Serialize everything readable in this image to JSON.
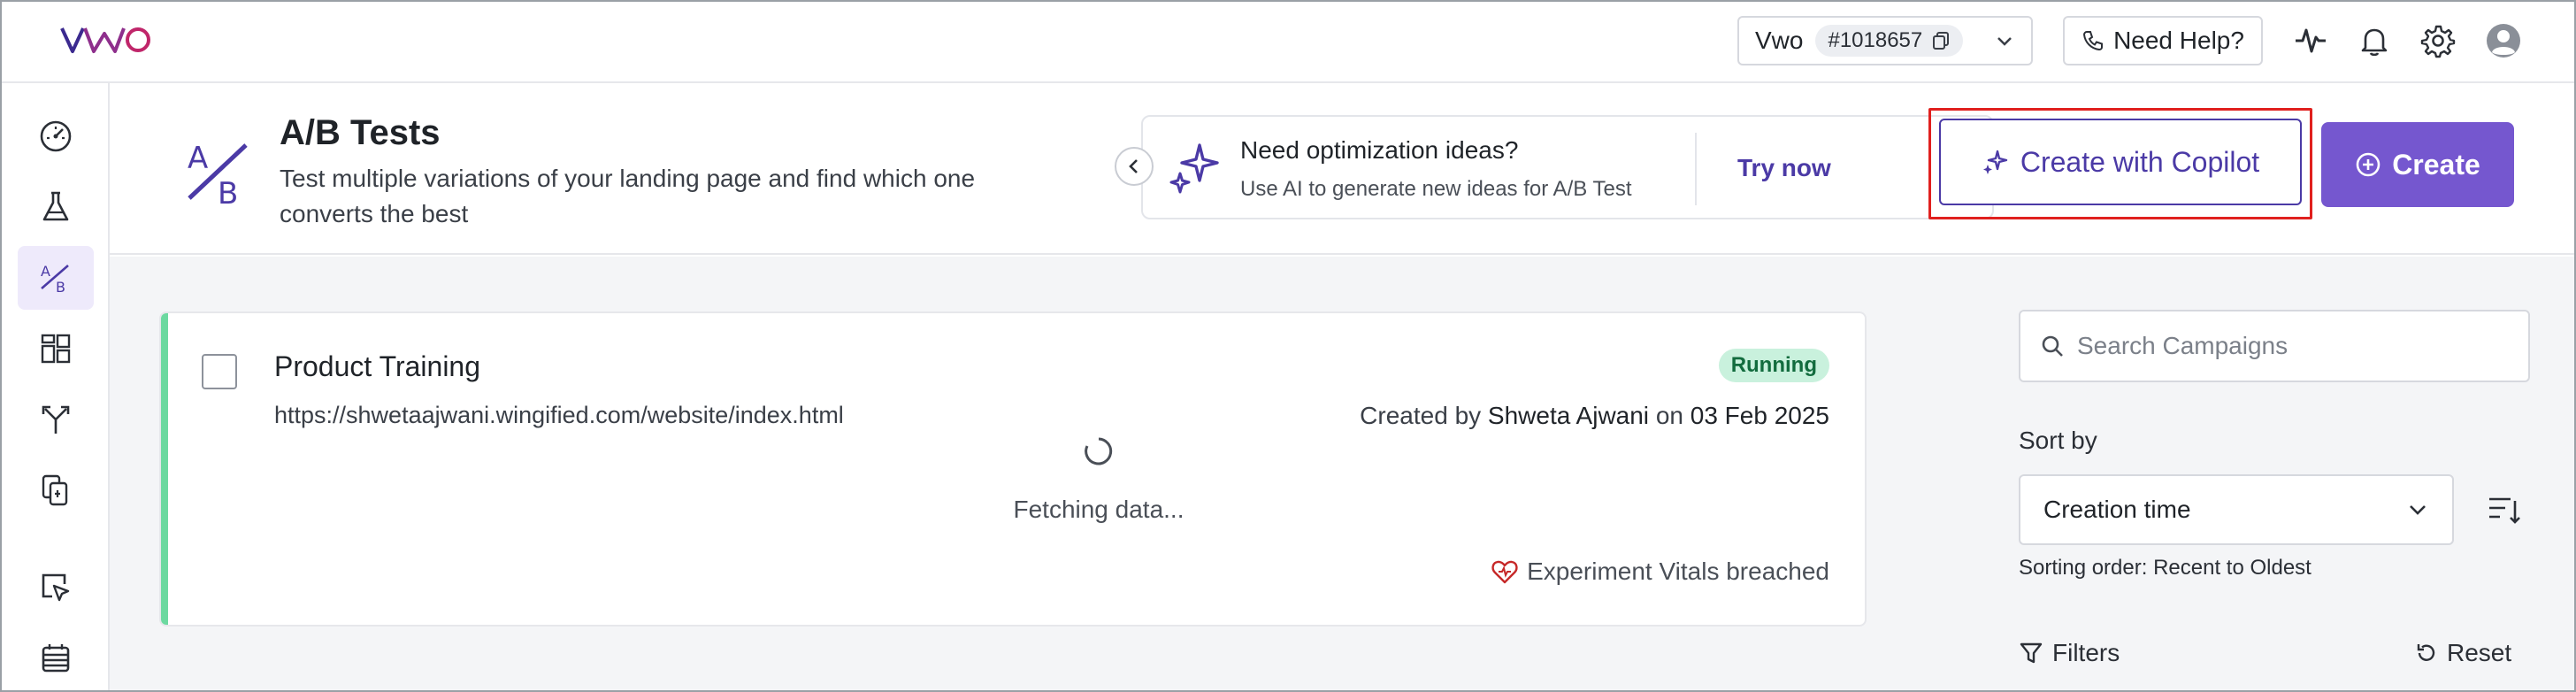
{
  "brand": {
    "accent": "#7557cf",
    "accent_dark": "#4b3aa6",
    "status_running": "#c9f1dd",
    "highlight": "#e0201e",
    "card_accent": "#6cd9a0"
  },
  "topbar": {
    "logo": "VWO",
    "account_name": "Vwo",
    "account_id": "#1018657",
    "help_label": "Need Help?",
    "icons": [
      "vitals-icon",
      "bell-icon",
      "gear-icon",
      "user-avatar-icon"
    ]
  },
  "sidebar": {
    "items": [
      {
        "icon": "dashboard-gauge-icon",
        "active": false
      },
      {
        "icon": "flask-icon",
        "active": false
      },
      {
        "icon": "ab-test-icon",
        "active": true
      },
      {
        "icon": "grid-icon",
        "active": false
      },
      {
        "icon": "split-url-icon",
        "active": false
      },
      {
        "icon": "multi-page-icon",
        "active": false
      },
      {
        "icon": "cursor-area-icon",
        "active": false
      },
      {
        "icon": "calendar-icon",
        "active": false
      }
    ]
  },
  "header": {
    "title": "A/B Tests",
    "subtitle": "Test multiple variations of your landing page and find which one converts the best",
    "promo": {
      "title": "Need optimization ideas?",
      "description": "Use AI to generate new ideas for A/B Test",
      "cta": "Try now"
    },
    "copilot_label": "Create with Copilot",
    "create_label": "Create"
  },
  "campaign": {
    "name": "Product Training",
    "url": "https://shwetaajwani.wingified.com/website/index.html",
    "status": "Running",
    "created_prefix": "Created by",
    "created_by": "Shweta Ajwani",
    "created_on_word": "on",
    "created_date": "03 Feb 2025",
    "loading_text": "Fetching data...",
    "vitals_text": "Experiment Vitals breached"
  },
  "filters_panel": {
    "search_placeholder": "Search Campaigns",
    "sort_label": "Sort by",
    "sort_value": "Creation time",
    "sort_order": "Sorting order: Recent to Oldest",
    "filters_label": "Filters",
    "reset_label": "Reset"
  }
}
